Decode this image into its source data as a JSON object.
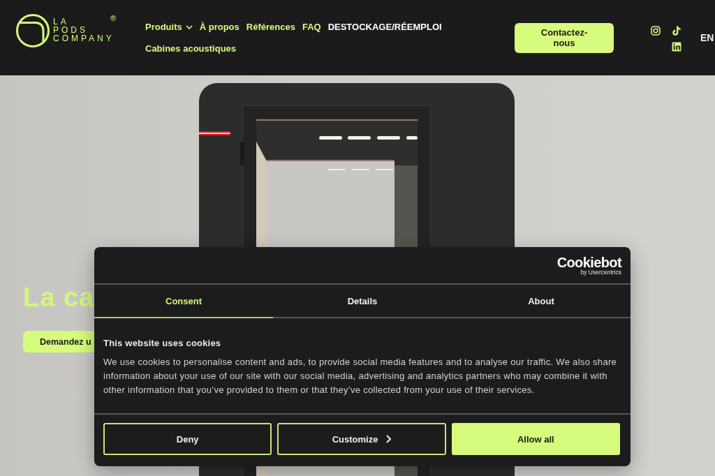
{
  "header": {
    "logo": {
      "lines": [
        "LA",
        "PODS",
        "COMPANY"
      ],
      "mark": "®"
    },
    "nav": [
      {
        "label": "Produits",
        "dropdown": true,
        "highlighted": false
      },
      {
        "label": "À propos",
        "dropdown": false,
        "highlighted": false
      },
      {
        "label": "Références",
        "dropdown": false,
        "highlighted": false
      },
      {
        "label": "FAQ",
        "dropdown": false,
        "highlighted": false
      },
      {
        "label": "DESTOCKAGE/RÉEMPLOI",
        "dropdown": false,
        "highlighted": true
      },
      {
        "label": "Cabines acoustiques",
        "dropdown": false,
        "highlighted": false
      }
    ],
    "contact_button": "Contactez-nous",
    "language": "EN"
  },
  "hero": {
    "title": "La ca",
    "cta": "Demandez u"
  },
  "cookie_dialog": {
    "brand": "Cookiebot",
    "brand_sub": "by Usercentrics",
    "tabs": [
      {
        "label": "Consent",
        "selected": true
      },
      {
        "label": "Details",
        "selected": false
      },
      {
        "label": "About",
        "selected": false
      }
    ],
    "title": "This website uses cookies",
    "text": "We use cookies to personalise content and ads, to provide social media features and to analyse our traffic. We also share information about your use of our site with our social media, advertising and analytics partners who may combine it with other information that you’ve provided to them or that they’ve collected from your use of their services.",
    "buttons": [
      {
        "label": "Deny",
        "kind": "outline"
      },
      {
        "label": "Customize",
        "kind": "next"
      },
      {
        "label": "Allow all",
        "kind": "primary"
      }
    ]
  }
}
